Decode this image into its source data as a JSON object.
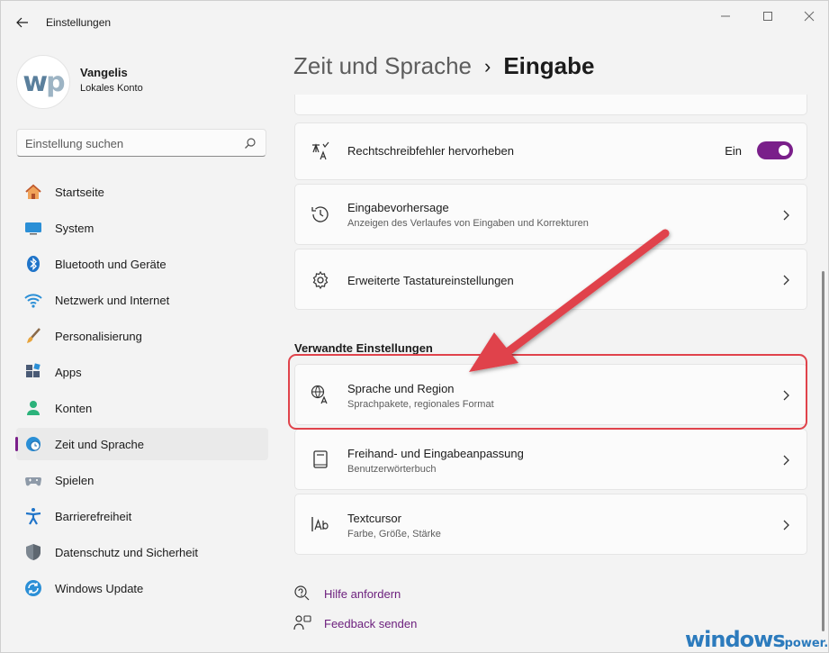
{
  "app": {
    "title": "Einstellungen"
  },
  "profile": {
    "name": "Vangelis",
    "account_type": "Lokales Konto",
    "avatar_text_w": "w",
    "avatar_text_p": "p"
  },
  "search": {
    "placeholder": "Einstellung suchen"
  },
  "nav": {
    "items": [
      {
        "label": "Startseite",
        "icon": "home-icon"
      },
      {
        "label": "System",
        "icon": "monitor-icon"
      },
      {
        "label": "Bluetooth und Geräte",
        "icon": "bluetooth-icon"
      },
      {
        "label": "Netzwerk und Internet",
        "icon": "wifi-icon"
      },
      {
        "label": "Personalisierung",
        "icon": "brush-icon"
      },
      {
        "label": "Apps",
        "icon": "apps-icon"
      },
      {
        "label": "Konten",
        "icon": "person-icon"
      },
      {
        "label": "Zeit und Sprache",
        "icon": "globe-clock-icon",
        "active": true
      },
      {
        "label": "Spielen",
        "icon": "gamepad-icon"
      },
      {
        "label": "Barrierefreiheit",
        "icon": "accessibility-icon"
      },
      {
        "label": "Datenschutz und Sicherheit",
        "icon": "shield-icon"
      },
      {
        "label": "Windows Update",
        "icon": "update-icon"
      }
    ]
  },
  "header": {
    "parent": "Zeit und Sprache",
    "separator": "›",
    "current": "Eingabe"
  },
  "content": {
    "spell": {
      "title": "Rechtschreibfehler hervorheben",
      "state": "Ein"
    },
    "prediction": {
      "title": "Eingabevorhersage",
      "subtitle": "Anzeigen des Verlaufes von Eingaben und Korrekturen"
    },
    "advanced": {
      "title": "Erweiterte Tastatureinstellungen"
    },
    "related_heading": "Verwandte Einstellungen",
    "region": {
      "title": "Sprache und Region",
      "subtitle": "Sprachpakete, regionales Format"
    },
    "ink": {
      "title": "Freihand- und Eingabeanpassung",
      "subtitle": "Benutzerwörterbuch"
    },
    "cursor": {
      "title": "Textcursor",
      "subtitle": "Farbe, Größe, Stärke"
    }
  },
  "links": {
    "help": "Hilfe anfordern",
    "feedback": "Feedback senden"
  },
  "watermark": {
    "main": "windows",
    "suffix": "power."
  },
  "colors": {
    "accent": "#7a1f8a",
    "annotation": "#e0434b",
    "link": "#6b1e7c"
  }
}
